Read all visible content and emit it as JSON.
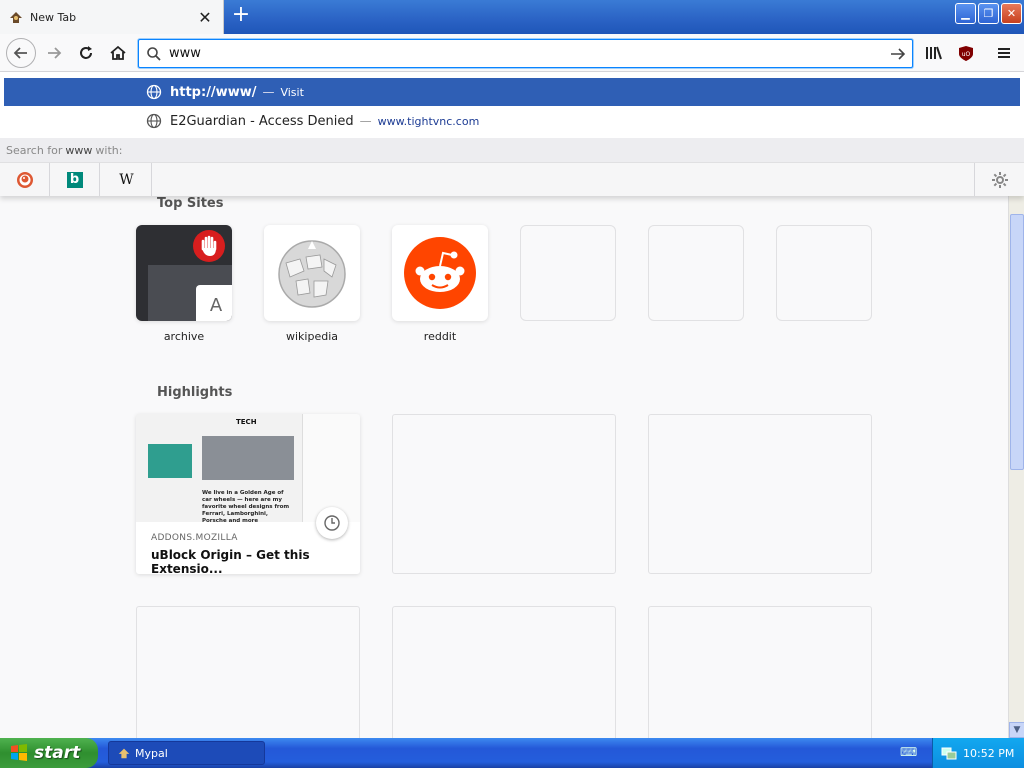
{
  "browser": {
    "tab": {
      "title": "New Tab",
      "close": "✕"
    },
    "new_tab": "+",
    "window_buttons": {
      "minimize": "▁",
      "restore": "❐",
      "close": "✕"
    }
  },
  "toolbar": {
    "url_value": "www"
  },
  "url_results": {
    "primary": {
      "title": "http://www/",
      "separator": "—",
      "action": "Visit"
    },
    "secondary": {
      "title": "E2Guardian - Access Denied",
      "separator": "—",
      "url": "www.tightvnc.com"
    },
    "search_for_prefix": "Search for",
    "search_term": "www",
    "search_for_suffix": "with:",
    "engines": [
      "duckduckgo-icon",
      "bing-icon",
      "wikipedia-icon"
    ],
    "wikipedia_glyph": "W",
    "bing_glyph": "b"
  },
  "newtab": {
    "top_sites_heading": "Top Sites",
    "top_sites": [
      {
        "label": "archive",
        "letter": "A"
      },
      {
        "label": "wikipedia"
      },
      {
        "label": "reddit"
      }
    ],
    "highlights_heading": "Highlights",
    "highlight": {
      "source": "ADDONS.MOZILLA",
      "title": "uBlock Origin – Get this Extensio...",
      "thumb_heading": "TECH",
      "thumb_text": "We live in a Golden Age of car wheels — here are my favorite wheel designs from Ferrari, Lamborghini, Porsche and more"
    }
  },
  "taskbar": {
    "start": "start",
    "task": "Mypal",
    "clock": "10:52 PM"
  },
  "colors": {
    "selected_result": "#2f5fb5",
    "reddit": "#ff4500",
    "ublock": "#800000",
    "xp_blue": "#245edc",
    "xp_green": "#3c9c3c"
  }
}
